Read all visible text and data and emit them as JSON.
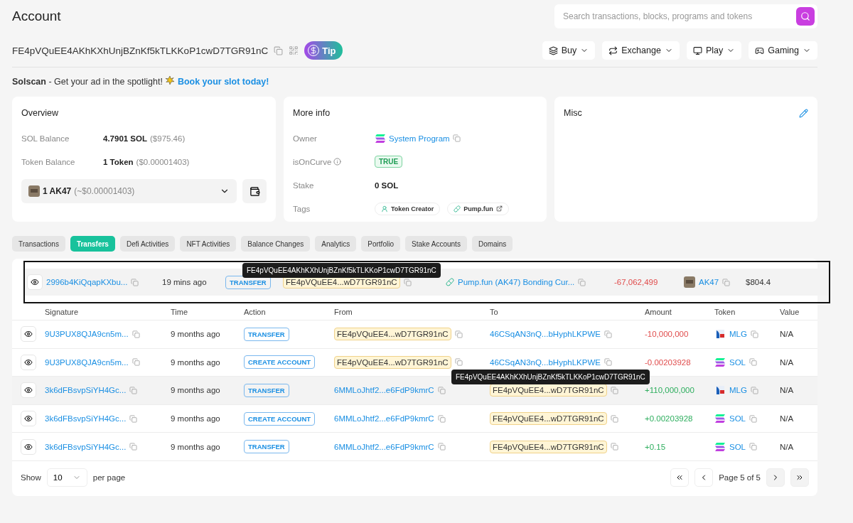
{
  "header": {
    "title": "Account",
    "search": {
      "placeholder": "Search transactions, blocks, programs and tokens"
    },
    "address": "FE4pVQuEE4AKhKXhUnjBZnKf5kTLKKoP1cwD7TGR91nC",
    "tip_label": "Tip",
    "menus": [
      {
        "label": "Buy",
        "kind": "layers"
      },
      {
        "label": "Exchange",
        "kind": "swap"
      },
      {
        "label": "Play",
        "kind": "monitor"
      },
      {
        "label": "Gaming",
        "kind": "gamepad"
      }
    ]
  },
  "ad": {
    "brand": "Solscan",
    "text": " - Get your ad in the spotlight! ",
    "link": "Book your slot today!"
  },
  "overview": {
    "title": "Overview",
    "rows": [
      {
        "label": "SOL Balance",
        "value": "4.7901 SOL",
        "sub": "($975.46)"
      },
      {
        "label": "Token Balance",
        "value": "1 Token",
        "sub": "($0.00001403)"
      }
    ],
    "token_select": {
      "value": "1 AK47",
      "sub": "(~$0.00001403)"
    }
  },
  "more_info": {
    "title": "More info",
    "owner_label": "Owner",
    "owner": "System Program",
    "curve_label": "isOnCurve",
    "curve": "TRUE",
    "stake_label": "Stake",
    "stake": "0 SOL",
    "tags_label": "Tags",
    "tags": [
      {
        "label": "Token Creator",
        "kind": "creator",
        "external": false
      },
      {
        "label": "Pump.fun",
        "kind": "pill",
        "external": true
      }
    ]
  },
  "misc": {
    "title": "Misc"
  },
  "tabs": [
    {
      "label": "Transactions",
      "selected": false
    },
    {
      "label": "Transfers",
      "selected": true
    },
    {
      "label": "Defi Activities",
      "selected": false
    },
    {
      "label": "NFT Activities",
      "selected": false
    },
    {
      "label": "Balance Changes",
      "selected": false
    },
    {
      "label": "Analytics",
      "selected": false
    },
    {
      "label": "Portfolio",
      "selected": false
    },
    {
      "label": "Stake Accounts",
      "selected": false
    },
    {
      "label": "Domains",
      "selected": false
    }
  ],
  "pasted_row": {
    "tooltip": "FE4pVQuEE4AKhKXhUnjBZnKf5kTLKKoP1cwD7TGR91nC",
    "row": {
      "signature": "2996b4KiQqapKXbu...",
      "time": "19 mins ago",
      "action": "TRANSFER",
      "from": "FE4pVQuEE4...wD7TGR91nC",
      "from_marked": true,
      "to": {
        "label": "Pump.fun (AK47) Bonding Cur...",
        "kind": "pill"
      },
      "to_marked": false,
      "amount": "-67,062,499",
      "negative": true,
      "token": {
        "label": "AK47",
        "kind": "avatar"
      },
      "value": "$804.4",
      "highlighted": true
    }
  },
  "table": {
    "columns": [
      "Signature",
      "Time",
      "Action",
      "From",
      "To",
      "Amount",
      "Token",
      "Value"
    ],
    "tooltip": "FE4pVQuEE4AKhKXhUnjBZnKf5kTLKKoP1cwD7TGR91nC",
    "rows": [
      {
        "signature": "9U3PUX8QJA9cn5m...",
        "time": "9 months ago",
        "action": "TRANSFER",
        "from": "FE4pVQuEE4...wD7TGR91nC",
        "from_marked": true,
        "to": {
          "label": "46CSqAN3nQ...bHyphLKPWE"
        },
        "to_marked": false,
        "amount": "-10,000,000",
        "negative": true,
        "token": {
          "label": "MLG",
          "kind": "badge"
        },
        "value": "N/A",
        "highlighted": false
      },
      {
        "signature": "9U3PUX8QJA9cn5m...",
        "time": "9 months ago",
        "action": "CREATE ACCOUNT",
        "from": "FE4pVQuEE4...wD7TGR91nC",
        "from_marked": true,
        "to": {
          "label": "46CSqAN3nQ...bHyphLKPWE"
        },
        "to_marked": false,
        "amount": "-0.00203928",
        "negative": true,
        "token": {
          "label": "SOL",
          "kind": "sol"
        },
        "value": "N/A",
        "highlighted": false
      },
      {
        "signature": "3k6dFBsvpSiYH4Gc...",
        "time": "9 months ago",
        "action": "TRANSFER",
        "from": "6MMLoJhtf2...e6FdP9kmrC",
        "from_marked": false,
        "to": {
          "label": "FE4pVQuEE4...wD7TGR91nC"
        },
        "to_marked": true,
        "amount": "+110,000,000",
        "negative": false,
        "token": {
          "label": "MLG",
          "kind": "badge"
        },
        "value": "N/A",
        "highlighted": true
      },
      {
        "signature": "3k6dFBsvpSiYH4Gc...",
        "time": "9 months ago",
        "action": "CREATE ACCOUNT",
        "from": "6MMLoJhtf2...e6FdP9kmrC",
        "from_marked": false,
        "to": {
          "label": "FE4pVQuEE4...wD7TGR91nC"
        },
        "to_marked": true,
        "amount": "+0.00203928",
        "negative": false,
        "token": {
          "label": "SOL",
          "kind": "sol"
        },
        "value": "N/A",
        "highlighted": false
      },
      {
        "signature": "3k6dFBsvpSiYH4Gc...",
        "time": "9 months ago",
        "action": "TRANSFER",
        "from": "6MMLoJhtf2...e6FdP9kmrC",
        "from_marked": false,
        "to": {
          "label": "FE4pVQuEE4...wD7TGR91nC"
        },
        "to_marked": true,
        "amount": "+0.15",
        "negative": false,
        "token": {
          "label": "SOL",
          "kind": "sol"
        },
        "value": "N/A",
        "highlighted": false
      }
    ]
  },
  "pagination": {
    "show_label": "Show",
    "per_page": "10",
    "per_page_label": "per page",
    "page_text": "Page 5 of 5"
  }
}
